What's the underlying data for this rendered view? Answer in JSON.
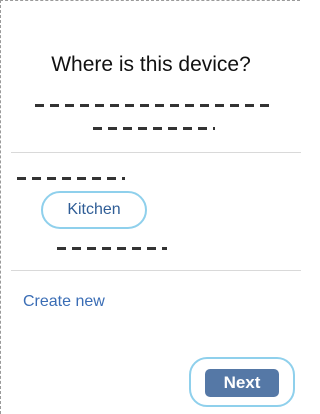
{
  "header": {
    "title": "Where is this device?"
  },
  "rooms": {
    "items": [
      {
        "label": "Kitchen"
      }
    ]
  },
  "actions": {
    "create_new_label": "Create new",
    "next_label": "Next"
  },
  "colors": {
    "accent": "#5578a6",
    "link": "#3a6db5",
    "focus_ring": "#8fd0ec"
  }
}
